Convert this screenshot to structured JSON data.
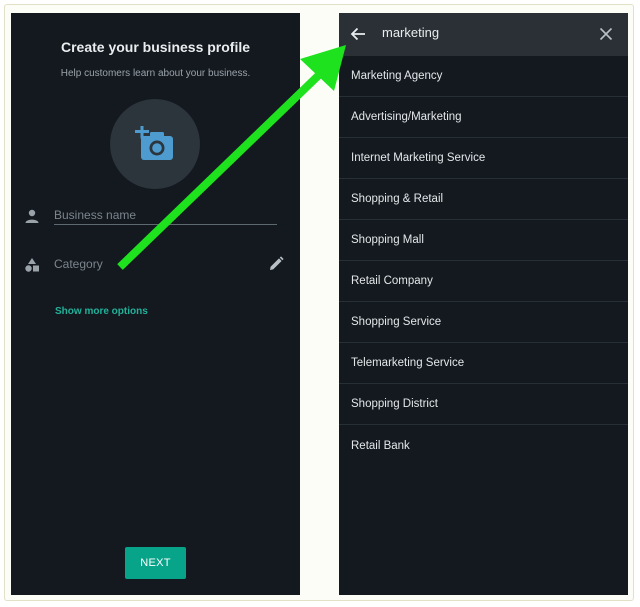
{
  "profile": {
    "title": "Create your business profile",
    "subtitle": "Help customers learn about your business.",
    "photo_icon": "add-photo-icon",
    "business_name_placeholder": "Business name",
    "category_label": "Category",
    "show_more_label": "Show more options",
    "next_label": "NEXT"
  },
  "search": {
    "query": "marketing",
    "results": [
      "Marketing Agency",
      "Advertising/Marketing",
      "Internet Marketing Service",
      "Shopping & Retail",
      "Shopping Mall",
      "Retail Company",
      "Shopping Service",
      "Telemarketing Service",
      "Shopping District",
      "Retail Bank"
    ]
  },
  "colors": {
    "screen_bg": "#14191f",
    "accent": "#08a48a",
    "link": "#21b19a",
    "annotation_arrow": "#1fe21f"
  }
}
